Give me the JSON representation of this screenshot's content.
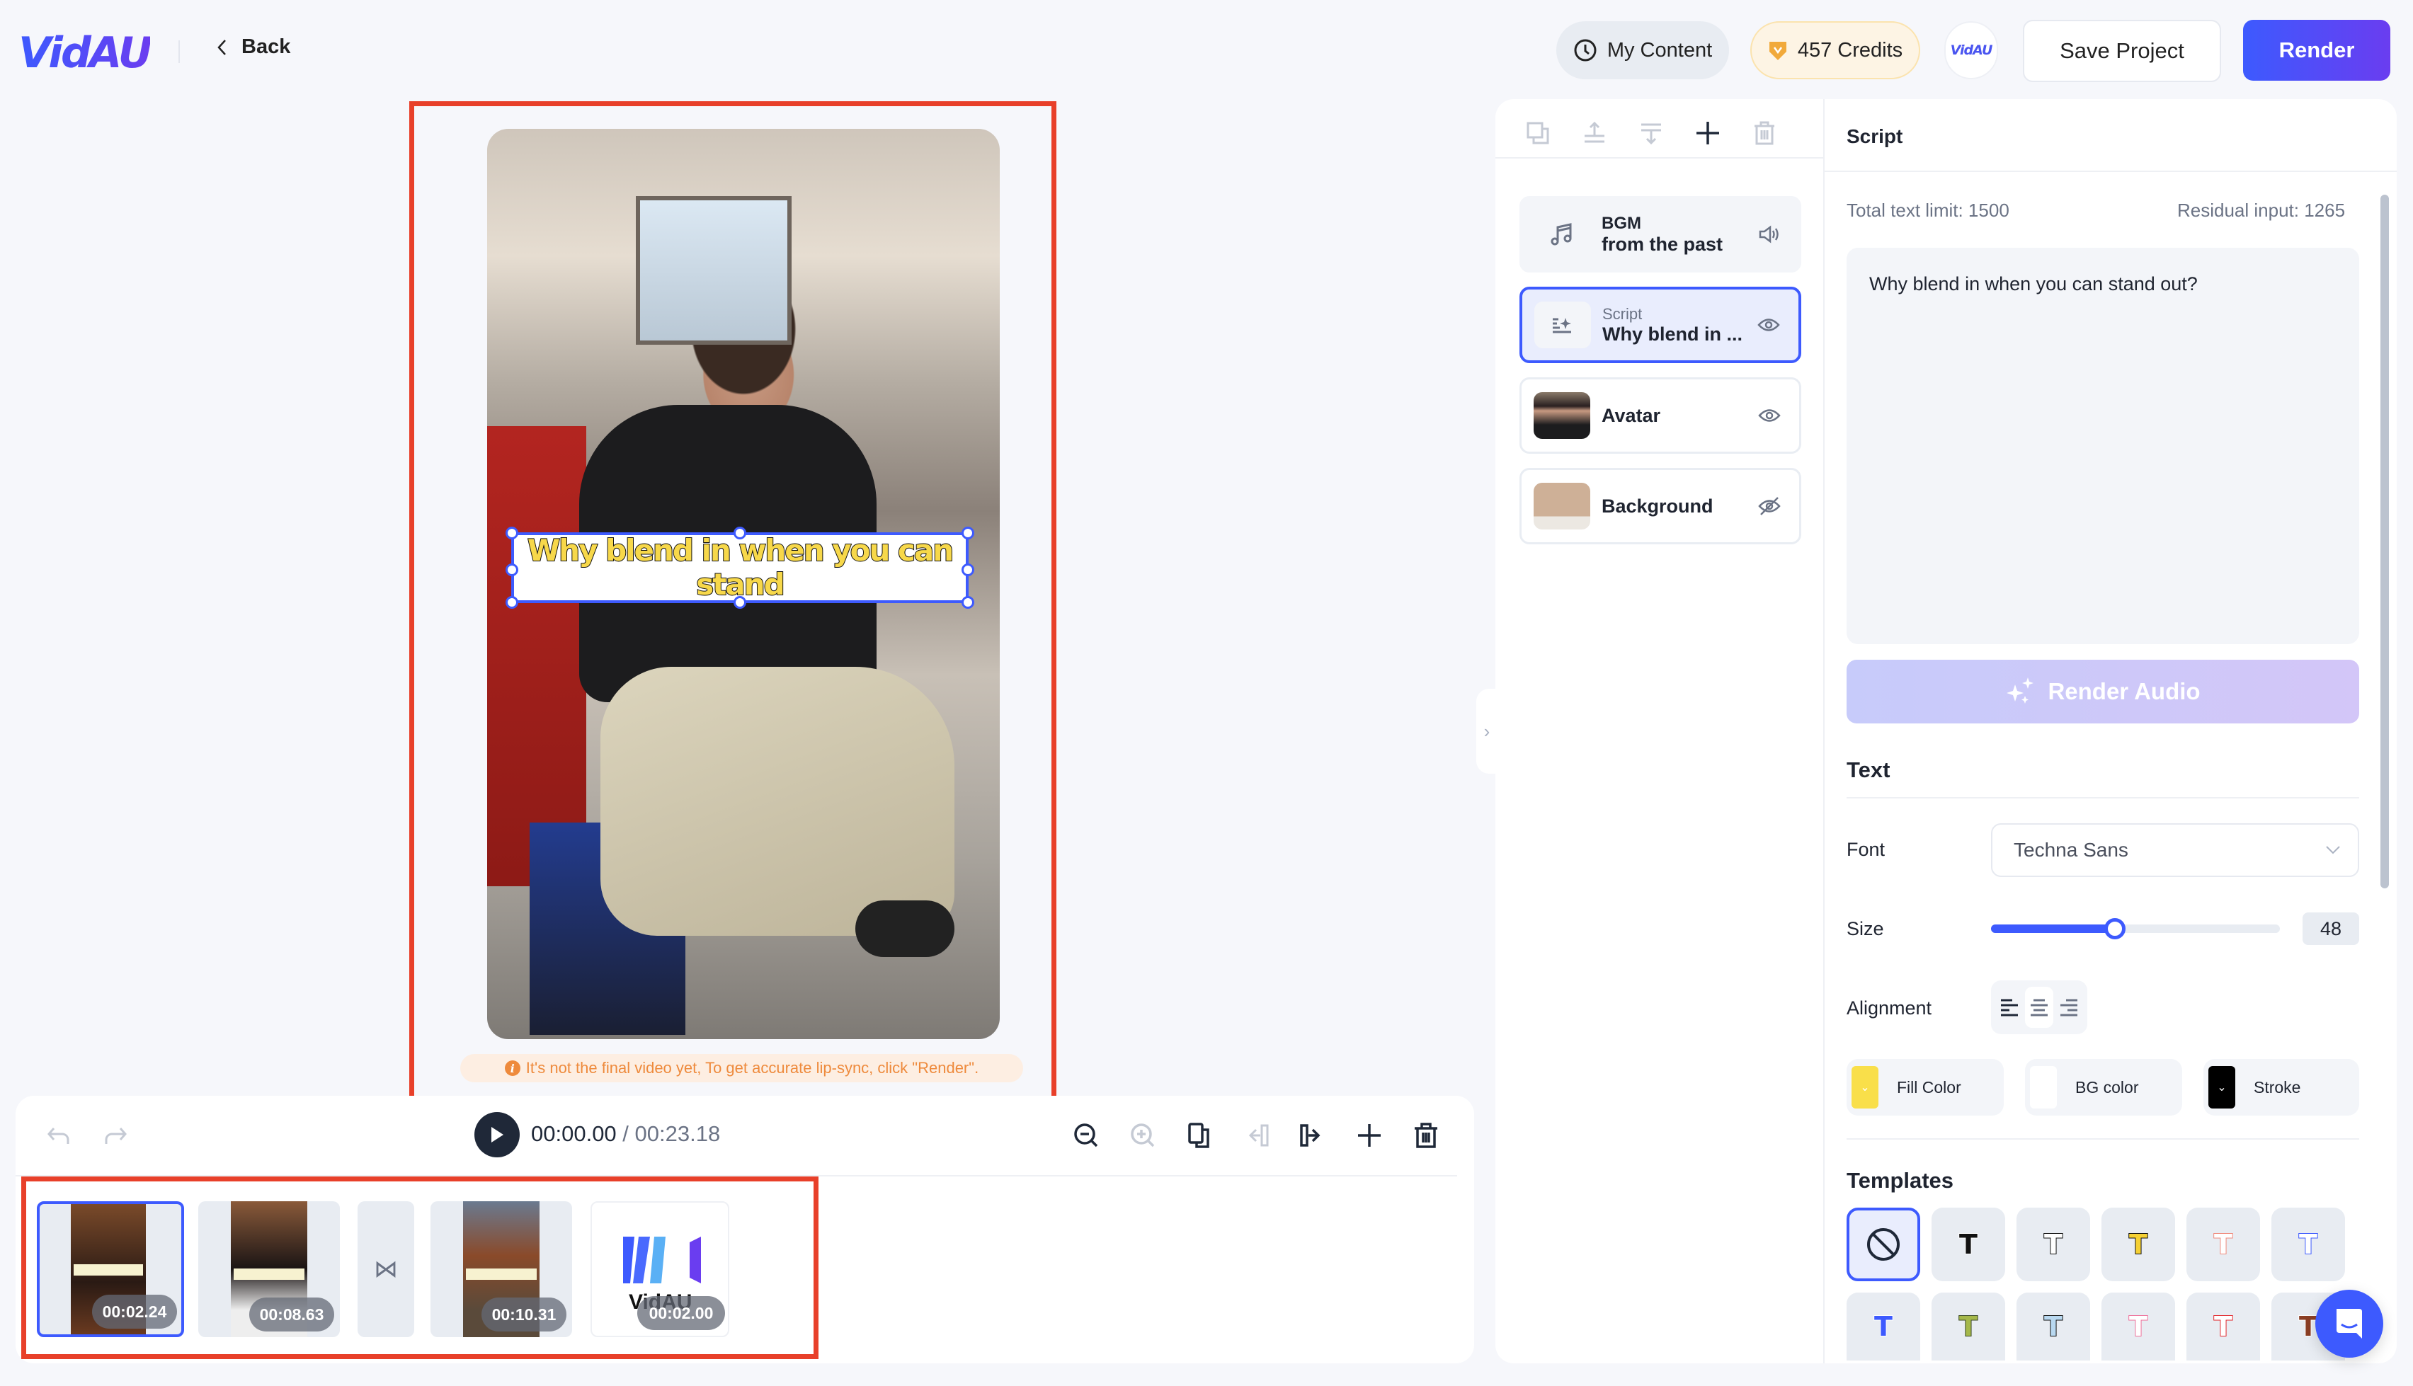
{
  "header": {
    "logo": "VidAU",
    "back_label": "Back",
    "my_content_label": "My Content",
    "credits_label": "457 Credits",
    "avatar_label": "VidAU",
    "save_label": "Save Project",
    "render_label": "Render"
  },
  "preview": {
    "caption_line1": "Why blend in when you can",
    "caption_line2": "stand",
    "notice": "It's not the final video yet, To get accurate lip-sync, click \"Render\"."
  },
  "timeline": {
    "current_time": "00:00.00",
    "separator": " / ",
    "total_time": "00:23.18",
    "clips": [
      {
        "duration": "00:02.24",
        "selected": true
      },
      {
        "duration": "00:08.63",
        "selected": false
      },
      {
        "duration": "00:10.31",
        "selected": false
      },
      {
        "duration": "00:02.00",
        "selected": false,
        "label": "VidAU"
      }
    ],
    "transition_icon": "⋈"
  },
  "layers": {
    "items": [
      {
        "sub": "BGM",
        "title": "from the past",
        "icon": "music-note",
        "end_icon": "volume"
      },
      {
        "sub": "Script",
        "title": "Why blend in ...",
        "icon": "text-sparkle",
        "end_icon": "eye",
        "active": true
      },
      {
        "sub": "",
        "title": "Avatar",
        "icon": "avatar-thumb",
        "end_icon": "eye"
      },
      {
        "sub": "",
        "title": "Background",
        "icon": "background-thumb",
        "end_icon": "eye-off"
      }
    ]
  },
  "script": {
    "title": "Script",
    "limit_label": "Total text limit: 1500",
    "residual_label": "Residual input: 1265",
    "text": "Why blend in when you can stand out?",
    "render_audio_label": "Render Audio"
  },
  "text_settings": {
    "section_title": "Text",
    "font_label": "Font",
    "font_value": "Techna Sans",
    "size_label": "Size",
    "size_value": "48",
    "size_fraction": 0.43,
    "alignment_label": "Alignment",
    "alignment_selected": "center",
    "fill_color_label": "Fill Color",
    "fill_color": "#f9df4a",
    "bg_color_label": "BG color",
    "bg_color": "#ffffff",
    "stroke_label": "Stroke",
    "stroke_color": "#000000"
  },
  "templates": {
    "title": "Templates",
    "items": [
      {
        "glyph": "none",
        "fill": "",
        "stroke": ""
      },
      {
        "glyph": "T",
        "fill": "#111111",
        "stroke": "#ffffff"
      },
      {
        "glyph": "T",
        "fill": "#ffffff",
        "stroke": "#111111"
      },
      {
        "glyph": "T",
        "fill": "#f5d033",
        "stroke": "#111111"
      },
      {
        "glyph": "T",
        "fill": "#ffffff",
        "stroke": "#f08a7c"
      },
      {
        "glyph": "T",
        "fill": "#ffffff",
        "stroke": "#3d5afe"
      },
      {
        "glyph": "T",
        "fill": "#3d5afe",
        "stroke": "#ffffff"
      },
      {
        "glyph": "T",
        "fill": "#a5b84a",
        "stroke": "#3b4a25"
      },
      {
        "glyph": "T",
        "fill": "#b8d8f0",
        "stroke": "#111111"
      },
      {
        "glyph": "T",
        "fill": "#ffffff",
        "stroke": "#ef6f9a"
      },
      {
        "glyph": "T",
        "fill": "#ffffff",
        "stroke": "#e3262b"
      },
      {
        "glyph": "T",
        "fill": "#8b3e24",
        "stroke": "#ffffff"
      }
    ]
  },
  "colors": {
    "accent": "#3d5afe",
    "highlight_frame": "#e8402a",
    "notice": "#ee8a3c"
  }
}
